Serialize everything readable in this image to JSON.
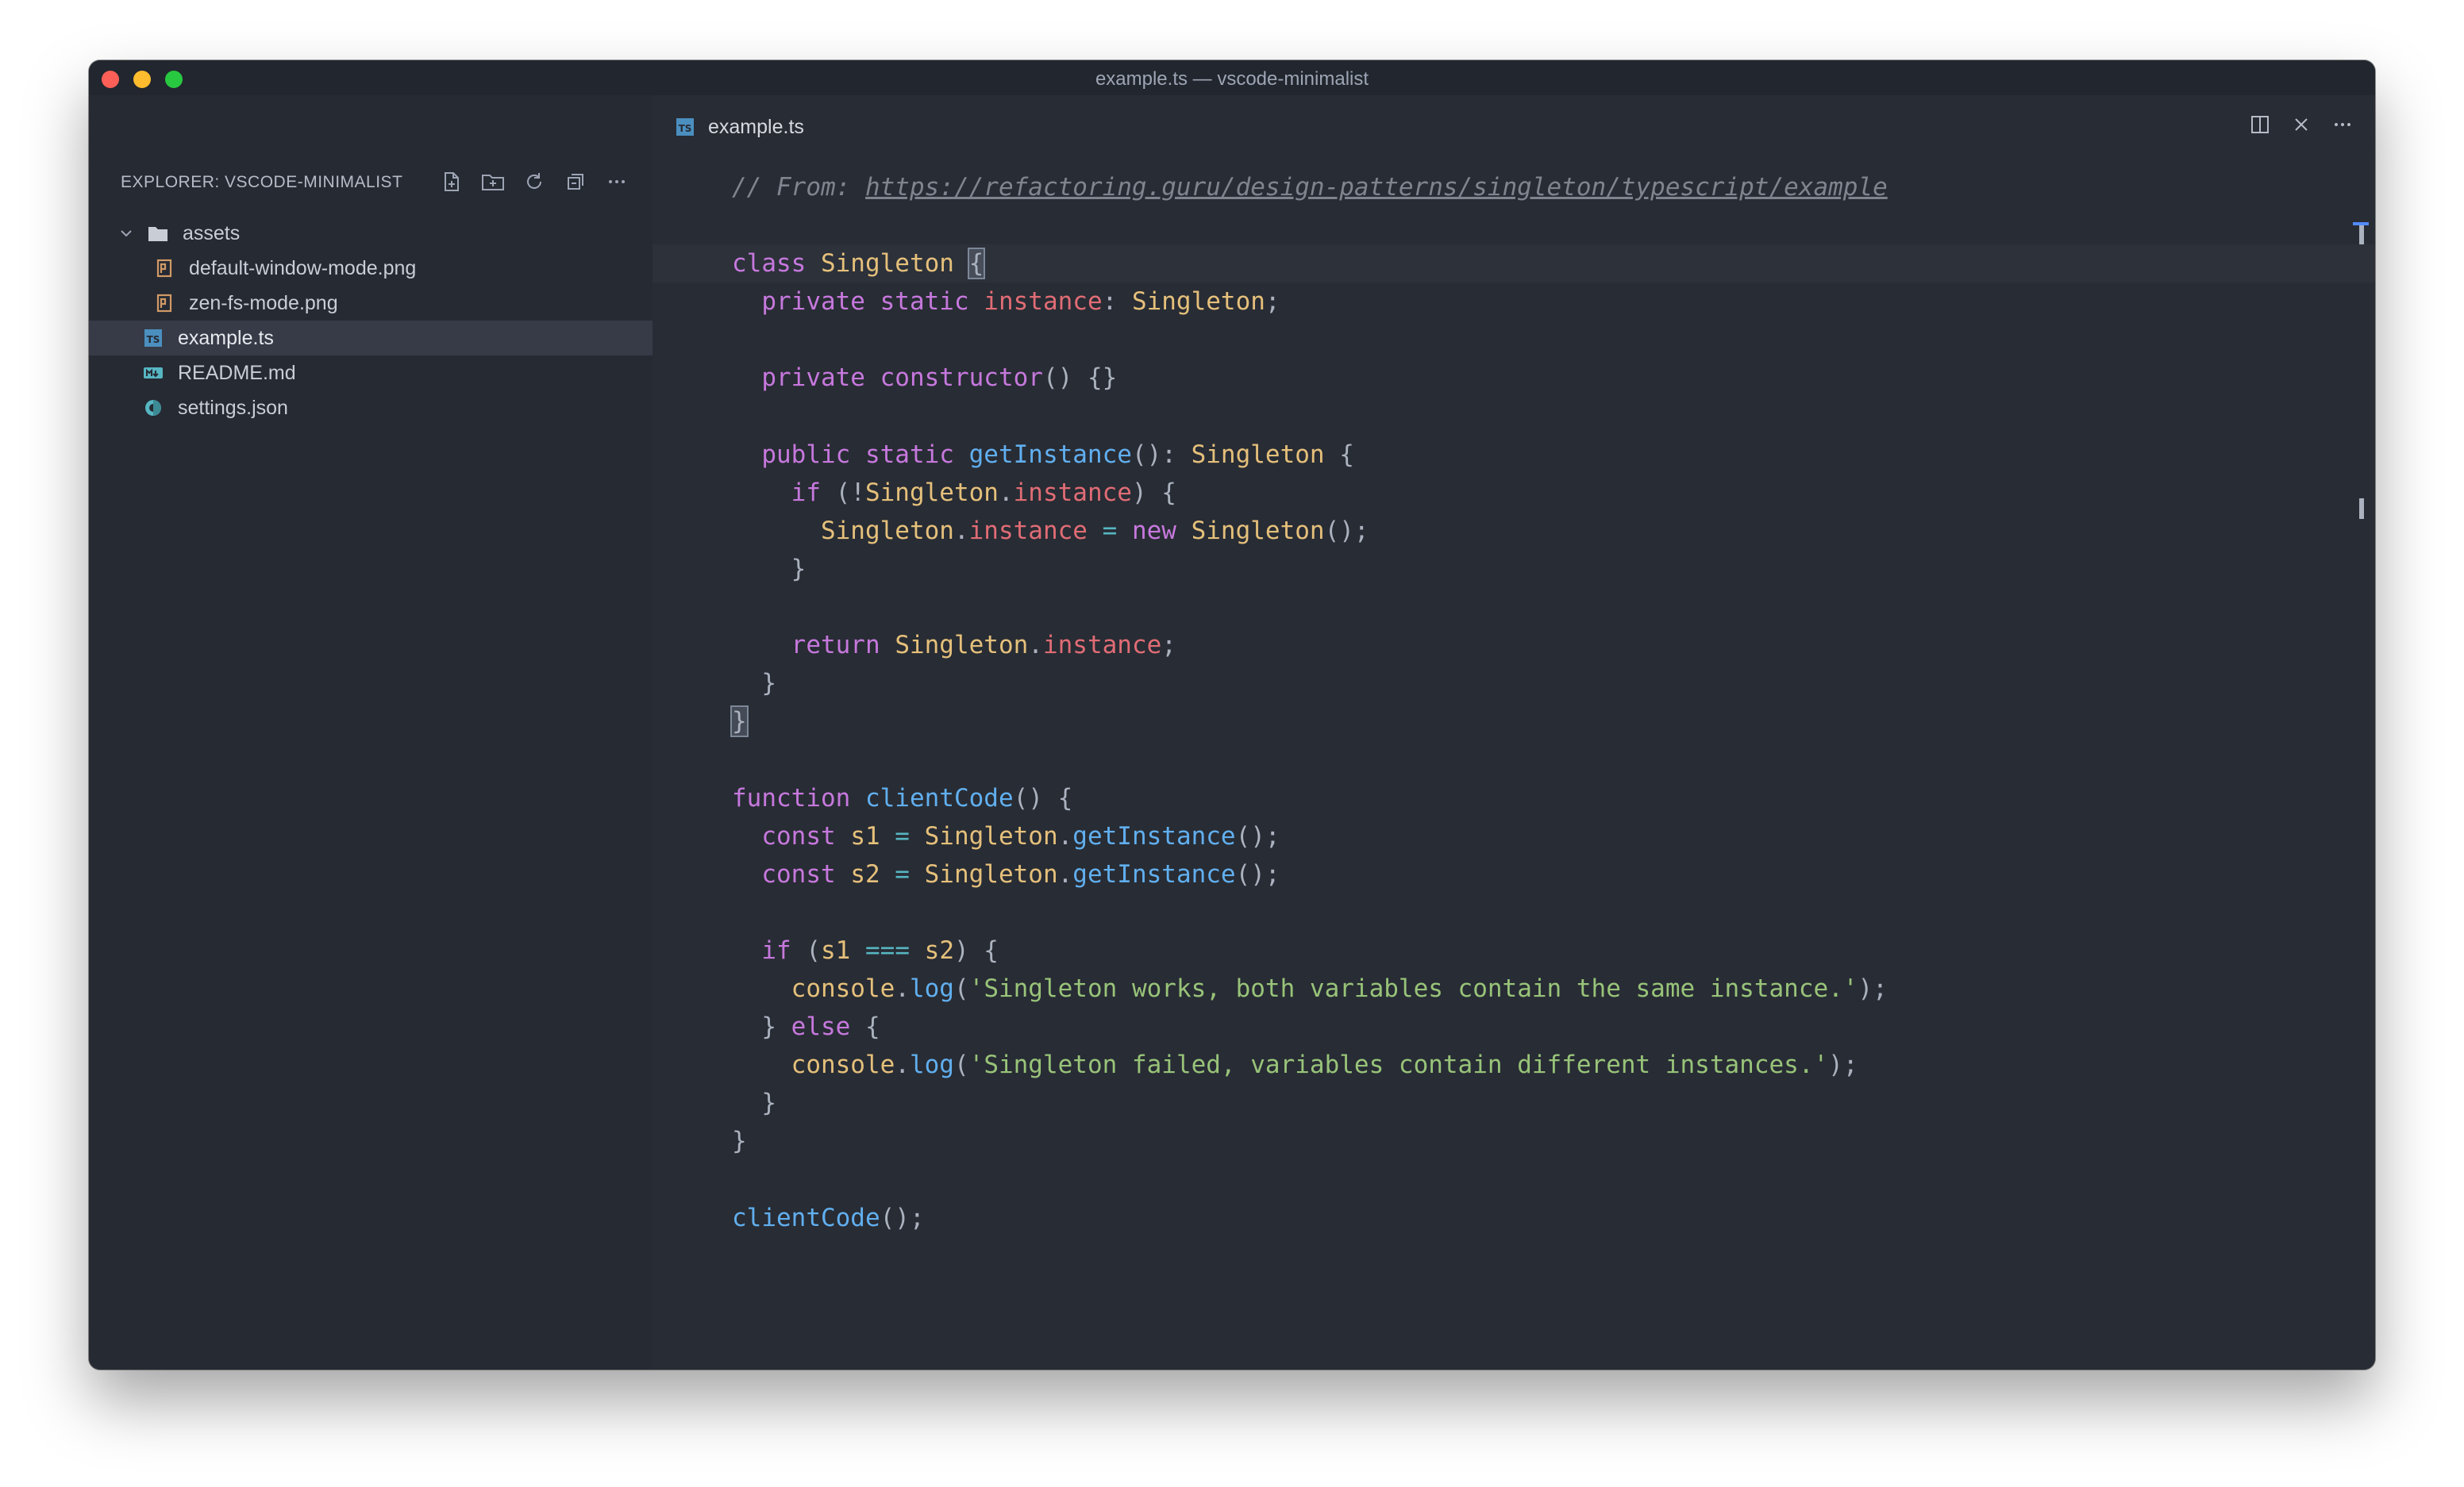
{
  "window": {
    "title": "example.ts — vscode-minimalist"
  },
  "sidebar": {
    "title": "EXPLORER: VSCODE-MINIMALIST",
    "actions": [
      {
        "icon": "new-file-icon"
      },
      {
        "icon": "new-folder-icon"
      },
      {
        "icon": "refresh-icon"
      },
      {
        "icon": "collapse-all-icon"
      },
      {
        "icon": "more-icon"
      }
    ],
    "tree": [
      {
        "label": "assets",
        "type": "folder",
        "indent": 0
      },
      {
        "label": "default-window-mode.png",
        "type": "png",
        "indent": 1
      },
      {
        "label": "zen-fs-mode.png",
        "type": "png",
        "indent": 1
      },
      {
        "label": "example.ts",
        "type": "ts",
        "indent": 0,
        "selected": true
      },
      {
        "label": "README.md",
        "type": "md",
        "indent": 0
      },
      {
        "label": "settings.json",
        "type": "json",
        "indent": 0
      }
    ]
  },
  "editor": {
    "tab_label": "example.ts",
    "code": [
      [
        [
          "c-comment",
          "// From: "
        ],
        [
          "c-link",
          "https://refactoring.guru/design-patterns/singleton/typescript/example"
        ]
      ],
      [],
      [
        [
          "c-kw",
          "class "
        ],
        [
          "c-cls",
          "Singleton "
        ],
        [
          "bracket",
          "{"
        ]
      ],
      [
        [
          "",
          "  "
        ],
        [
          "c-kw",
          "private static "
        ],
        [
          "c-prop",
          "instance"
        ],
        [
          "c-punc",
          ": "
        ],
        [
          "c-cls",
          "Singleton"
        ],
        [
          "c-punc",
          ";"
        ]
      ],
      [],
      [
        [
          "",
          "  "
        ],
        [
          "c-kw",
          "private "
        ],
        [
          "c-kw",
          "constructor"
        ],
        [
          "c-punc",
          "() {}"
        ]
      ],
      [],
      [
        [
          "",
          "  "
        ],
        [
          "c-kw",
          "public static "
        ],
        [
          "c-fn",
          "getInstance"
        ],
        [
          "c-punc",
          "(): "
        ],
        [
          "c-cls",
          "Singleton"
        ],
        [
          "c-punc",
          " {"
        ]
      ],
      [
        [
          "",
          "    "
        ],
        [
          "c-kw",
          "if "
        ],
        [
          "c-punc",
          "(!"
        ],
        [
          "c-var",
          "Singleton"
        ],
        [
          "c-punc",
          "."
        ],
        [
          "c-prop",
          "instance"
        ],
        [
          "c-punc",
          ") {"
        ]
      ],
      [
        [
          "",
          "      "
        ],
        [
          "c-var",
          "Singleton"
        ],
        [
          "c-punc",
          "."
        ],
        [
          "c-prop",
          "instance"
        ],
        [
          "c-op",
          " = "
        ],
        [
          "c-kw",
          "new "
        ],
        [
          "c-cls",
          "Singleton"
        ],
        [
          "c-punc",
          "();"
        ]
      ],
      [
        [
          "c-punc",
          "    }"
        ]
      ],
      [],
      [
        [
          "",
          "    "
        ],
        [
          "c-kw",
          "return "
        ],
        [
          "c-var",
          "Singleton"
        ],
        [
          "c-punc",
          "."
        ],
        [
          "c-prop",
          "instance"
        ],
        [
          "c-punc",
          ";"
        ]
      ],
      [
        [
          "c-punc",
          "  }"
        ]
      ],
      [
        [
          "bracket",
          "}"
        ]
      ],
      [],
      [
        [
          "c-kw",
          "function "
        ],
        [
          "c-fn",
          "clientCode"
        ],
        [
          "c-punc",
          "() {"
        ]
      ],
      [
        [
          "",
          "  "
        ],
        [
          "c-kw",
          "const "
        ],
        [
          "c-var",
          "s1"
        ],
        [
          "c-op",
          " = "
        ],
        [
          "c-var",
          "Singleton"
        ],
        [
          "c-punc",
          "."
        ],
        [
          "c-fn",
          "getInstance"
        ],
        [
          "c-punc",
          "();"
        ]
      ],
      [
        [
          "",
          "  "
        ],
        [
          "c-kw",
          "const "
        ],
        [
          "c-var",
          "s2"
        ],
        [
          "c-op",
          " = "
        ],
        [
          "c-var",
          "Singleton"
        ],
        [
          "c-punc",
          "."
        ],
        [
          "c-fn",
          "getInstance"
        ],
        [
          "c-punc",
          "();"
        ]
      ],
      [],
      [
        [
          "",
          "  "
        ],
        [
          "c-kw",
          "if "
        ],
        [
          "c-punc",
          "("
        ],
        [
          "c-var",
          "s1"
        ],
        [
          "c-op",
          " === "
        ],
        [
          "c-var",
          "s2"
        ],
        [
          "c-punc",
          ") {"
        ]
      ],
      [
        [
          "",
          "    "
        ],
        [
          "c-var",
          "console"
        ],
        [
          "c-punc",
          "."
        ],
        [
          "c-fn",
          "log"
        ],
        [
          "c-punc",
          "("
        ],
        [
          "c-str",
          "'Singleton works, both variables contain the same instance.'"
        ],
        [
          "c-punc",
          ");"
        ]
      ],
      [
        [
          "",
          "  "
        ],
        [
          "c-punc",
          "} "
        ],
        [
          "c-kw",
          "else "
        ],
        [
          "c-punc",
          "{"
        ]
      ],
      [
        [
          "",
          "    "
        ],
        [
          "c-var",
          "console"
        ],
        [
          "c-punc",
          "."
        ],
        [
          "c-fn",
          "log"
        ],
        [
          "c-punc",
          "("
        ],
        [
          "c-str",
          "'Singleton failed, variables contain different instances.'"
        ],
        [
          "c-punc",
          ");"
        ]
      ],
      [
        [
          "c-punc",
          "  }"
        ]
      ],
      [
        [
          "c-punc",
          "}"
        ]
      ],
      [],
      [
        [
          "c-fn",
          "clientCode"
        ],
        [
          "c-punc",
          "();"
        ]
      ]
    ]
  },
  "colors": {
    "editor_bg": "#282c34",
    "sidebar_bg": "#262a33",
    "selection_bg": "#363b47",
    "keyword": "#c678dd",
    "class": "#e5c07b",
    "property": "#e06c75",
    "function": "#61afef",
    "string": "#98c379",
    "comment": "#7f848e"
  }
}
